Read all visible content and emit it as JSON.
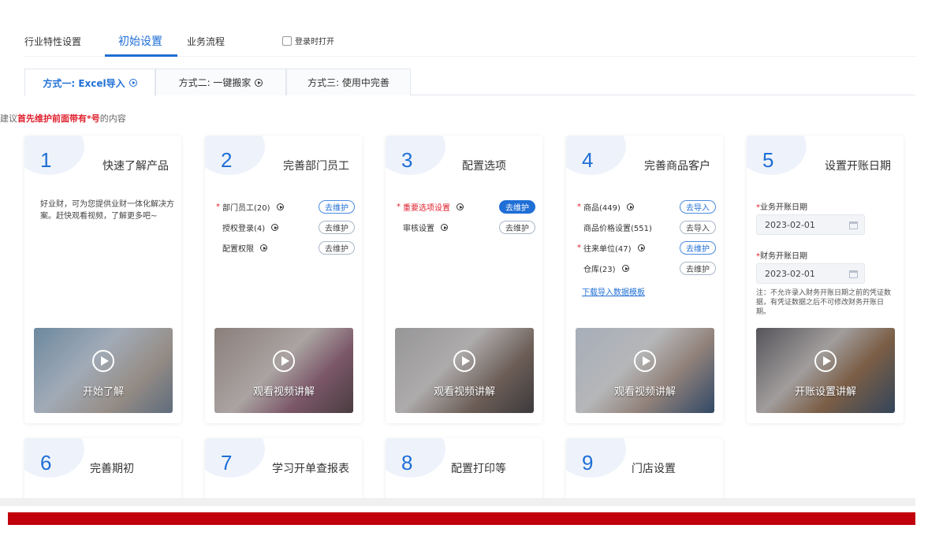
{
  "top_tabs": [
    {
      "label": "行业特性设置"
    },
    {
      "label": "初始设置"
    },
    {
      "label": "业务流程"
    }
  ],
  "login_open_label": "登录时打开",
  "method_tabs": [
    {
      "label": "方式一: Excel导入"
    },
    {
      "label": "方式二: 一键搬家"
    },
    {
      "label": "方式三: 使用中完善"
    }
  ],
  "hint": {
    "prefix": "建议",
    "highlight": "首先维护前面带有*号",
    "suffix": "的内容"
  },
  "cards": {
    "c1": {
      "num": "1",
      "title": "快速了解产品",
      "desc": "好业财，可为您提供业财一体化解决方案。赶快观看视频，了解更多吧~",
      "video": "开始了解"
    },
    "c2": {
      "num": "2",
      "title": "完善部门员工",
      "rows": [
        {
          "label": "部门员工(20)",
          "btn": "去维护"
        },
        {
          "label": "授权登录(4)",
          "btn": "去维护"
        },
        {
          "label": "配置权限",
          "btn": "去维护"
        }
      ],
      "video": "观看视频讲解"
    },
    "c3": {
      "num": "3",
      "title": "配置选项",
      "rows": [
        {
          "label": "重要选项设置",
          "btn": "去维护"
        },
        {
          "label": "审核设置",
          "btn": "去维护"
        }
      ],
      "video": "观看视频讲解"
    },
    "c4": {
      "num": "4",
      "title": "完善商品客户",
      "rows": [
        {
          "label": "商品(449)",
          "btn": "去导入"
        },
        {
          "label": "商品价格设置(551)",
          "btn": "去导入"
        },
        {
          "label": "往来单位(47)",
          "btn": "去维护"
        },
        {
          "label": "仓库(23)",
          "btn": "去维护"
        }
      ],
      "link": "下载导入数据模板",
      "video": "观看视频讲解"
    },
    "c5": {
      "num": "5",
      "title": "设置开账日期",
      "biz_label": "业务开账日期",
      "biz_date": "2023-02-01",
      "fin_label": "财务开账日期",
      "fin_date": "2023-02-01",
      "note": "注：不允许录入财务开账日期之前的凭证数据，有凭证数据之后不可修改财务开账日期。",
      "video": "开账设置讲解"
    },
    "c6": {
      "num": "6",
      "title": "完善期初"
    },
    "c7": {
      "num": "7",
      "title": "学习开单查报表"
    },
    "c8": {
      "num": "8",
      "title": "配置打印等"
    },
    "c9": {
      "num": "9",
      "title": "门店设置"
    }
  },
  "colors": {
    "accent": "#1f6fd6",
    "required": "#e0202d",
    "footer_red": "#c1000b"
  }
}
